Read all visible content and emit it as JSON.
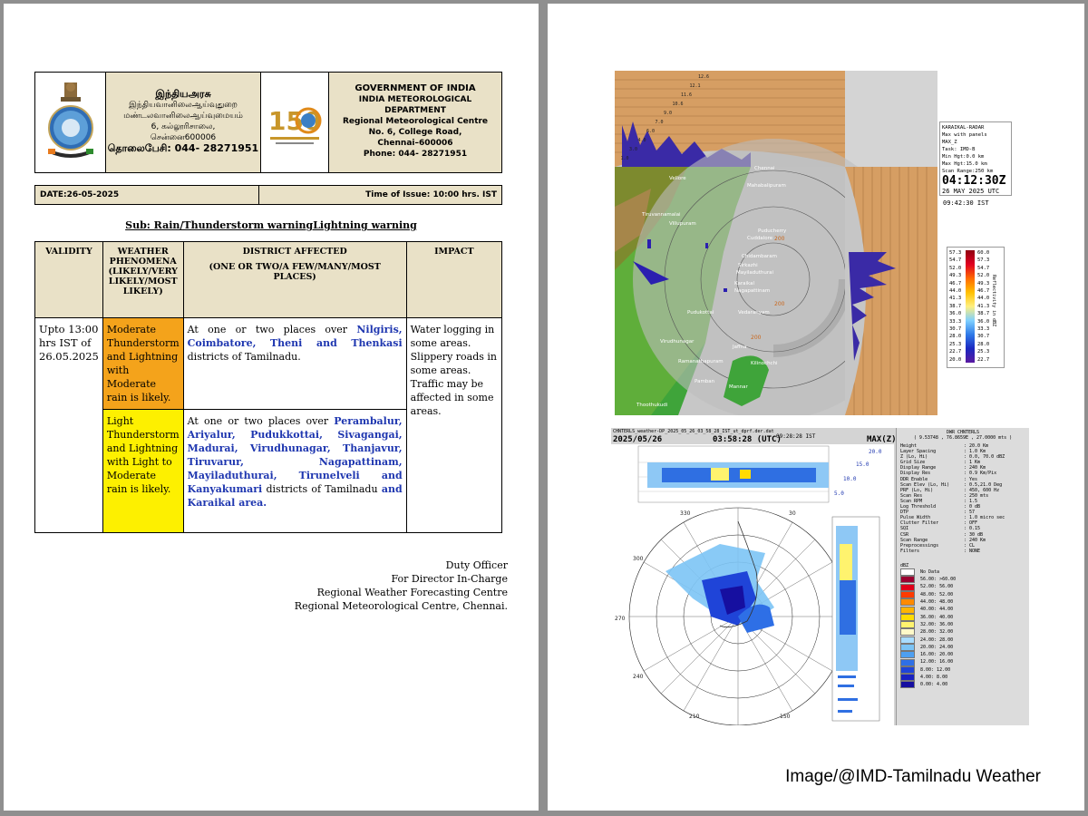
{
  "header": {
    "tamil_title": "இந்தியஅரசு",
    "tamil_dept": "இந்தியவானிலைஆய்வுதுறை",
    "tamil_centre": "மண்டலவானிலைஆய்வுமையம்",
    "tamil_address": "6, கல்லூரிசாலை,",
    "tamil_city": "சென்னை600006",
    "tamil_phone": "தொலைபேசி: 044- 28271951",
    "logo_text": "150",
    "gov": "GOVERNMENT OF INDIA",
    "dept": "INDIA METEOROLOGICAL DEPARTMENT",
    "centre": "Regional Meteorological Centre",
    "address": "No. 6, College Road,",
    "city": "Chennai–600006",
    "phone": "Phone:  044- 28271951"
  },
  "date_row": {
    "date": "DATE:26-05-2025",
    "time": "Time of Issue: 10:00 hrs. IST"
  },
  "subject": "Sub: Rain/Thunderstorm warningLightning warning",
  "table": {
    "headers": {
      "validity": "VALIDITY",
      "phenomena": "WEATHER PHENOMENA (LIKELY/VERY LIKELY/MOST LIKELY)",
      "district": "DISTRICT AFFECTED",
      "district_sub": "(ONE OR TWO/A FEW/MANY/MOST PLACES)",
      "impact": "IMPACT"
    },
    "validity": "Upto 13:00 hrs IST of 26.05.2025",
    "impact": "Water logging in some areas. Slippery roads in some areas. Traffic may be affected in some areas.",
    "rows": [
      {
        "phenomena": "Moderate Thunderstorm and Lightning with Moderate rain is likely.",
        "color": "#f4a31b",
        "district_prefix": "At one or two places over ",
        "district_places": "Nilgiris, Coimbatore, Theni and Thenkasi",
        "district_suffix": " districts of Tamilnadu."
      },
      {
        "phenomena": "Light Thunderstorm and Lightning with Light to Moderate rain is likely.",
        "color": "#fdf000",
        "district_prefix": "At one or two places over ",
        "district_places": "Perambalur, Ariyalur, Pudukkottai, Sivagangai, Madurai, Virudhunagar, Thanjavur, Tiruvarur, Nagapattinam, Mayiladuthurai, Tirunelveli and Kanyakumari",
        "district_suffix": " districts  of Tamilnadu ",
        "district_tail": "and Karaikal area."
      }
    ]
  },
  "signature": {
    "line1": "Duty Officer",
    "line2": "For Director In-Charge",
    "line3": "Regional Weather Forecasting Centre",
    "line4": "Regional Meteorological Centre, Chennai."
  },
  "radar1": {
    "height_ticks": [
      "12.6",
      "12.1",
      "11.6",
      "10.6",
      "9.0",
      "7.0",
      "6.0",
      "4.0",
      "3.0",
      "1.0"
    ],
    "places": [
      "Chennai",
      "Mahabalipuram",
      "Puducherry",
      "Cuddalore",
      "Chidambaram",
      "Sirkazhi",
      "Mayiladuthurai",
      "Karaikal",
      "Nagapattinam",
      "Vedaranyam",
      "Jaffna",
      "Kilinochchi",
      "Mannar",
      "Thoothukudi",
      "Pudukottai",
      "Virudhunagar",
      "Ramanathapuram",
      "Pamban",
      "Vellore",
      "Villupuram",
      "Tiruvannamalai"
    ],
    "range_labels": [
      "200",
      "200",
      "200"
    ],
    "info_lines": [
      "KARAIKAL-RADAR",
      "Max with panels",
      "MAX_Z",
      "Task: IMD-B",
      "Min Hgt:0.0 km",
      "Max Hgt:15.0 km",
      "Scan Range:250 km"
    ],
    "time": "04:12:30Z",
    "date": "26 MAY 2025 UTC",
    "ist": "09:42:30 IST",
    "legend_left": [
      "57.3",
      "54.7",
      "52.0",
      "49.3",
      "46.7",
      "44.0",
      "41.3",
      "38.7",
      "36.0",
      "33.3",
      "30.7",
      "28.0",
      "25.3",
      "22.7",
      "20.0"
    ],
    "legend_right": [
      "60.0",
      "57.3",
      "54.7",
      "52.0",
      "49.3",
      "46.7",
      "44.0",
      "41.3",
      "38.7",
      "36.0",
      "33.3",
      "30.7",
      "28.0",
      "25.3",
      "22.7"
    ],
    "legend_title": "Reflectivity in dBZ"
  },
  "radar2": {
    "title": "CHNTERLS_weather-DP_2025_05_26_03_58_28_IST_ut_dprf.der.dat",
    "date": "2025/05/26",
    "utc": "03:58:28 (UTC)",
    "ist": "09:28:28 IST",
    "mode": "MAX(Z)",
    "station": "DWR CHNTERLS",
    "coords": "( 9.53748 , 76.8659E , 27.0000 mts )",
    "params": [
      {
        "k": "Height",
        "v": ": 20.0 Km"
      },
      {
        "k": "Layer Spacing",
        "v": ": 1.0 Km"
      },
      {
        "k": "Z (Lo, Hi)",
        "v": ": 0.0, 70.0 dBZ"
      },
      {
        "k": "Grid Size",
        "v": ": 1 Km"
      },
      {
        "k": "Display Range",
        "v": ": 240 Km"
      },
      {
        "k": "Display Res",
        "v": ": 0.9 Km/Pix"
      },
      {
        "k": "DDR Enable",
        "v": ": Yes"
      },
      {
        "k": "Scan Elev (Lo, Hi)",
        "v": ": 0.5,21.0 Deg"
      },
      {
        "k": "PRF (Lo, Hi)",
        "v": ": 450, 600 Hz"
      },
      {
        "k": "Scan Res",
        "v": ": 250 mts"
      },
      {
        "k": "Scan RPM",
        "v": ": 1.5"
      },
      {
        "k": "Log Threshold",
        "v": ": 0 dB"
      },
      {
        "k": "DTP",
        "v": ": 57"
      },
      {
        "k": "Pulse Width",
        "v": ": 1.0 micro sec"
      },
      {
        "k": "Clutter Filter",
        "v": ": OFF"
      },
      {
        "k": "SQI",
        "v": ": 0.15"
      },
      {
        "k": "CSR",
        "v": ": 30 dB"
      },
      {
        "k": "Scan Range",
        "v": ": 240 Km"
      },
      {
        "k": "Preprocessings",
        "v": ": CL"
      },
      {
        "k": "Filters",
        "v": ": NONE"
      }
    ],
    "legend_unit": "dBZ",
    "legend": [
      {
        "label": "No Data",
        "color": "#ffffff"
      },
      {
        "label": "56.00: >60.00",
        "color": "#9c0030"
      },
      {
        "label": "52.00: 56.00",
        "color": "#e0001a"
      },
      {
        "label": "48.00: 52.00",
        "color": "#ff3a00"
      },
      {
        "label": "44.00: 48.00",
        "color": "#ff8a00"
      },
      {
        "label": "40.00: 44.00",
        "color": "#ffb400"
      },
      {
        "label": "36.00: 40.00",
        "color": "#ffdb00"
      },
      {
        "label": "32.00: 36.00",
        "color": "#fff36e"
      },
      {
        "label": "28.00: 32.00",
        "color": "#fff9c8"
      },
      {
        "label": "24.00: 28.00",
        "color": "#a8dcff"
      },
      {
        "label": "20.00: 24.00",
        "color": "#7cc4f5"
      },
      {
        "label": "16.00: 20.00",
        "color": "#4e9ff0"
      },
      {
        "label": "12.00: 16.00",
        "color": "#2e6fe6"
      },
      {
        "label": "8.00: 12.00",
        "color": "#1f44d8"
      },
      {
        "label": "4.00: 8.00",
        "color": "#1a22c0"
      },
      {
        "label": "0.00: 4.00",
        "color": "#160fa0"
      }
    ],
    "height_labels": [
      "20.0",
      "15.0",
      "10.0",
      "5.0"
    ],
    "azimuths": [
      "330",
      "30",
      "300",
      "60",
      "270",
      "90",
      "240",
      "120",
      "210",
      "150"
    ]
  },
  "credit": "Image/@IMD-Tamilnadu Weather"
}
